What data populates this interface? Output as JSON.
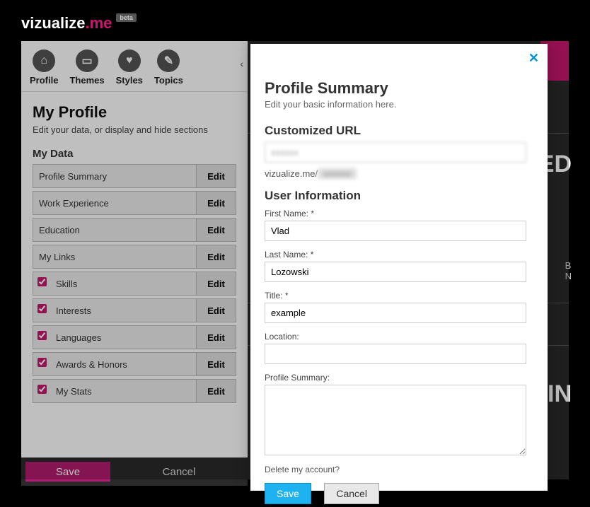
{
  "brand": {
    "part1": "vizualize",
    "part2": ".me",
    "beta": "beta"
  },
  "tabs": {
    "profile": "Profile",
    "themes": "Themes",
    "styles": "Styles",
    "topics": "Topics"
  },
  "page": {
    "title": "My Profile",
    "subtitle": "Edit your data, or display and hide sections"
  },
  "mydata": {
    "heading": "My Data",
    "edit": "Edit",
    "items": [
      {
        "label": "Profile Summary",
        "checkable": false,
        "checked": false
      },
      {
        "label": "Work Experience",
        "checkable": false,
        "checked": false
      },
      {
        "label": "Education",
        "checkable": false,
        "checked": false
      },
      {
        "label": "My Links",
        "checkable": false,
        "checked": false
      },
      {
        "label": "Skills",
        "checkable": true,
        "checked": true
      },
      {
        "label": "Interests",
        "checkable": true,
        "checked": true
      },
      {
        "label": "Languages",
        "checkable": true,
        "checked": true
      },
      {
        "label": "Awards & Honors",
        "checkable": true,
        "checked": true
      },
      {
        "label": "My Stats",
        "checkable": true,
        "checked": true
      }
    ]
  },
  "bottombar": {
    "save": "Save",
    "cancel": "Cancel"
  },
  "rightpanel": {
    "big1": "ED",
    "big2": "IN",
    "small1": "B",
    "small2": "N"
  },
  "modal": {
    "title": "Profile Summary",
    "subtitle": "Edit your basic information here.",
    "custom_url_heading": "Customized URL",
    "custom_url_value": "xxxxxx",
    "url_prefix": "vizualize.me/",
    "url_suffix": "xxxxxx",
    "user_info_heading": "User Information",
    "first_name_label": "First Name: *",
    "first_name_value": "Vlad",
    "last_name_label": "Last Name: *",
    "last_name_value": "Lozowski",
    "title_label": "Title: *",
    "title_value": "example",
    "location_label": "Location:",
    "location_value": "",
    "summary_label": "Profile Summary:",
    "summary_value": "",
    "delete_account": "Delete my account?",
    "save": "Save",
    "cancel": "Cancel"
  }
}
